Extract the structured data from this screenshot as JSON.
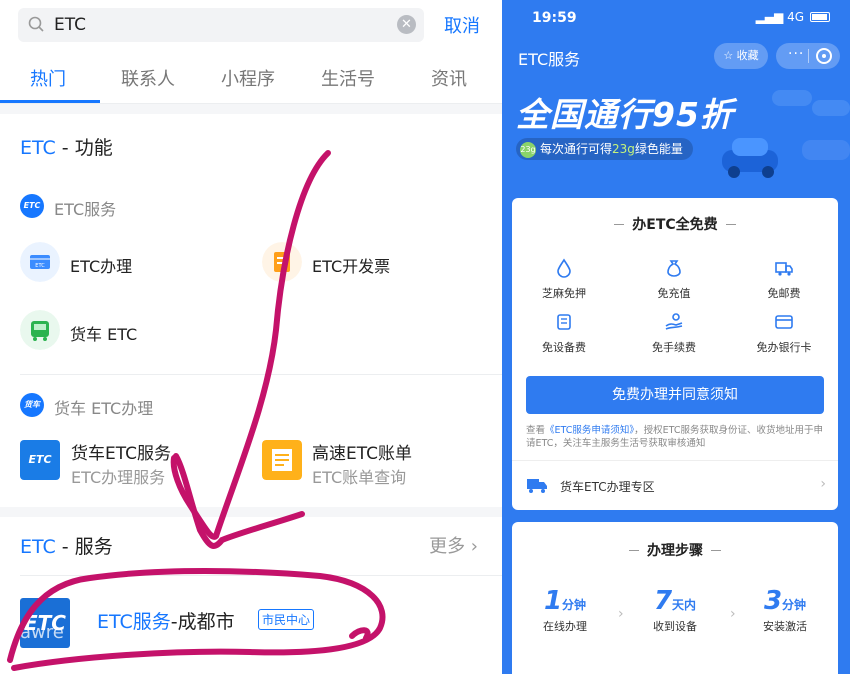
{
  "left": {
    "search": {
      "value": "ETC",
      "cancel_label": "取消"
    },
    "tabs": [
      {
        "label": "热门",
        "active": true
      },
      {
        "label": "联系人",
        "active": false
      },
      {
        "label": "小程序",
        "active": false
      },
      {
        "label": "生活号",
        "active": false
      },
      {
        "label": "资讯",
        "active": false
      }
    ],
    "function_section": {
      "title_prefix": "ETC",
      "title_suffix": " - 功能",
      "group1": {
        "logo_text": "ETC",
        "title": "ETC服务",
        "items": [
          {
            "label": "ETC办理",
            "icon": "etc-card-icon"
          },
          {
            "label": "ETC开发票",
            "icon": "invoice-icon"
          },
          {
            "label": "货车 ETC",
            "icon": "truck-bus-icon"
          }
        ]
      },
      "group2": {
        "logo_text": "货车ETC",
        "title": "货车 ETC办理",
        "items": [
          {
            "title": "货车ETC服务",
            "subtitle": "ETC办理服务",
            "icon_text": "ETC"
          },
          {
            "title": "高速ETC账单",
            "subtitle": "ETC账单查询",
            "icon": "bill-icon"
          }
        ]
      }
    },
    "service_section": {
      "title_prefix": "ETC",
      "title_suffix": " - 服务",
      "more_label": "更多",
      "result": {
        "logo_text": "ETC",
        "title_prefix": "ETC服务",
        "title_suffix": "-成都市",
        "tag": "市民中心",
        "watermark": "Lawre"
      }
    },
    "colors": {
      "accent": "#1677ff",
      "scribble": "#c4126a"
    }
  },
  "right": {
    "status": {
      "time": "19:59",
      "network": "4G"
    },
    "app_title": "ETC服务",
    "fav_label": "☆ 收藏",
    "menu_label": "···",
    "promo": {
      "headline": "全国通行95折",
      "pill_badge": "23g",
      "pill_text_a": "每次通行可得",
      "pill_text_g": "23g",
      "pill_text_b": "绿色能量"
    },
    "free_card": {
      "title": "办ETC全免费",
      "features": [
        {
          "label": "芝麻免押",
          "icon": "sesame-drop-icon"
        },
        {
          "label": "免充值",
          "icon": "money-bag-icon"
        },
        {
          "label": "免邮费",
          "icon": "delivery-truck-icon"
        },
        {
          "label": "免设备费",
          "icon": "device-icon"
        },
        {
          "label": "免手续费",
          "icon": "hand-coin-icon"
        },
        {
          "label": "免办银行卡",
          "icon": "bank-card-icon"
        }
      ],
      "button_label": "免费办理并同意须知",
      "notice_a": "查看",
      "notice_link": "《ETC服务申请须知》",
      "notice_b": "，授权ETC服务获取身份证、收货地址用于申请ETC，关注车主服务生活号获取审核通知",
      "truck_row_label": "货车ETC办理专区"
    },
    "steps_card": {
      "title": "办理步骤",
      "steps": [
        {
          "num": "1",
          "unit": "分钟",
          "label": "在线办理"
        },
        {
          "num": "7",
          "unit": "天内",
          "label": "收到设备"
        },
        {
          "num": "3",
          "unit": "分钟",
          "label": "安装激活"
        }
      ]
    },
    "colors": {
      "primary": "#2f7bf0"
    }
  }
}
